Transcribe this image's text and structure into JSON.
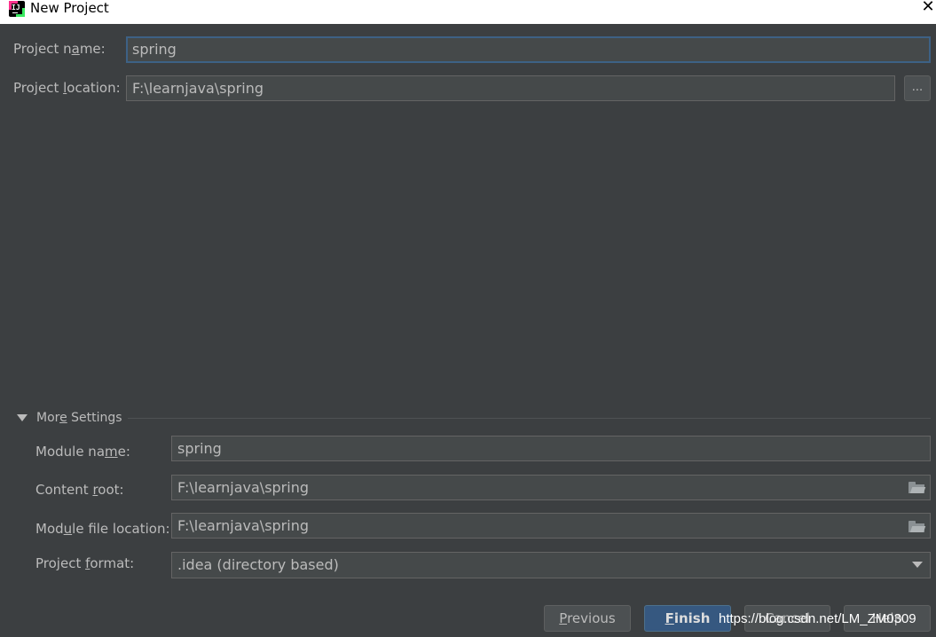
{
  "window": {
    "title": "New Project",
    "close_glyph": "✕"
  },
  "form": {
    "project_name": {
      "label_before": "Project n",
      "label_mnemonic": "a",
      "label_after": "me:",
      "value": "spring"
    },
    "project_location": {
      "label_before": "Project ",
      "label_mnemonic": "l",
      "label_after": "ocation:",
      "value": "F:\\learnjava\\spring",
      "browse_label": "..."
    }
  },
  "more_settings": {
    "label_before": "Mor",
    "label_mnemonic": "e",
    "label_after": " Settings",
    "expanded": true,
    "module_name": {
      "label_before": "Module na",
      "label_mnemonic": "m",
      "label_after": "e:",
      "value": "spring"
    },
    "content_root": {
      "label_before": "Content ",
      "label_mnemonic": "r",
      "label_after": "oot:",
      "value": "F:\\learnjava\\spring",
      "icon": "folder-icon"
    },
    "module_file_location": {
      "label_before": "Mod",
      "label_mnemonic": "u",
      "label_after": "le file location:",
      "value": "F:\\learnjava\\spring",
      "icon": "folder-icon"
    },
    "project_format": {
      "label_before": "Project ",
      "label_mnemonic": "f",
      "label_after": "ormat:",
      "selected": ".idea (directory based)"
    }
  },
  "buttons": {
    "previous": {
      "mnemonic": "P",
      "rest": "revious"
    },
    "finish": {
      "mnemonic": "F",
      "rest": "inish"
    },
    "cancel": "Cancel",
    "help": "Help"
  },
  "watermark": "https://blog.csdn.net/LM_ZM0309",
  "colors": {
    "background": "#3c3f41",
    "field_background": "#45494a",
    "focus_border": "#3d6185",
    "default_button": "#365880",
    "text": "#bbbbbb"
  }
}
